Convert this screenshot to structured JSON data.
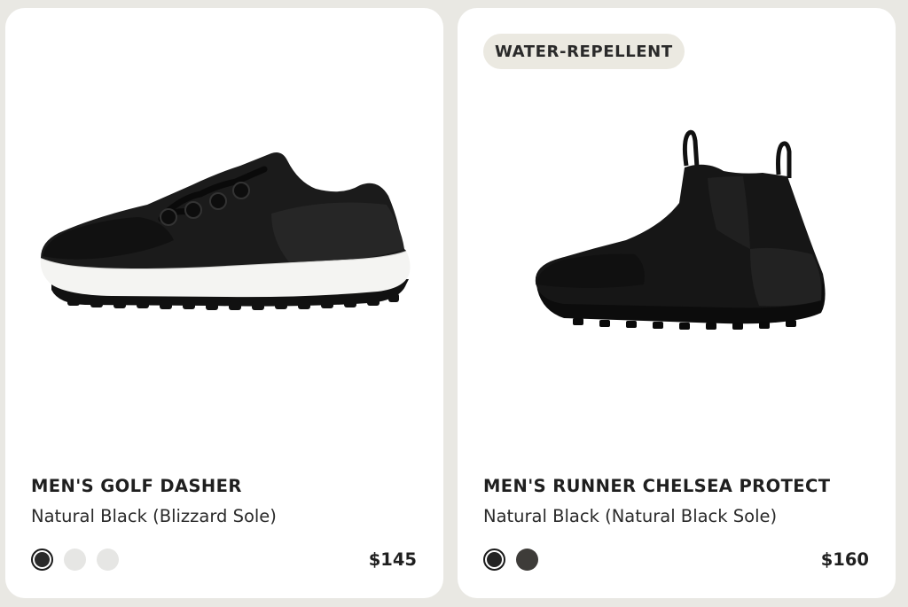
{
  "products": [
    {
      "name": "MEN'S GOLF DASHER",
      "colorway": "Natural Black (Blizzard Sole)",
      "price": "$145",
      "badge": "",
      "swatches": [
        {
          "color": "#2a2a2a",
          "selected": true
        },
        {
          "color": "#e6e6e4",
          "selected": false
        },
        {
          "color": "#e6e6e4",
          "selected": false
        }
      ]
    },
    {
      "name": "MEN'S RUNNER CHELSEA PROTECT",
      "colorway": "Natural Black (Natural Black Sole)",
      "price": "$160",
      "badge": "WATER-REPELLENT",
      "swatches": [
        {
          "color": "#232323",
          "selected": true
        },
        {
          "color": "#3e3c39",
          "selected": false
        }
      ]
    }
  ],
  "icons": {
    "product_image_1": "golf-shoe-image",
    "product_image_2": "chelsea-boot-image"
  }
}
